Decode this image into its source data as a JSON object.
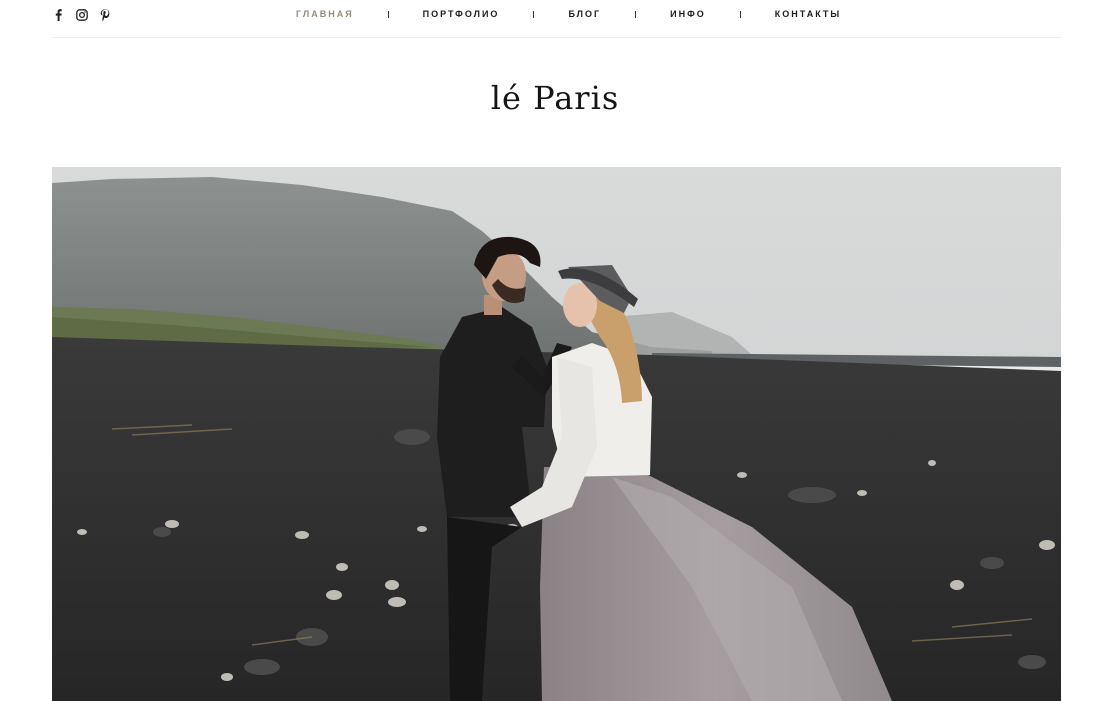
{
  "header": {
    "social": [
      {
        "icon": "facebook-icon",
        "symbol": "f"
      },
      {
        "icon": "instagram-icon",
        "symbol": "ig"
      },
      {
        "icon": "pinterest-icon",
        "symbol": "p"
      }
    ],
    "nav": {
      "items": [
        {
          "label": "ГЛАВНАЯ",
          "active": true
        },
        {
          "label": "ПОРТФОЛИО",
          "active": false
        },
        {
          "label": "БЛОГ",
          "active": false
        },
        {
          "label": "ИНФО",
          "active": false
        },
        {
          "label": "КОНТАКТЫ",
          "active": false
        }
      ],
      "active_color": "#9a8a7a",
      "text_color": "#1d1d1d"
    }
  },
  "site": {
    "title": "lé Paris"
  },
  "hero": {
    "image_subject": "couple-on-black-sand-beach-photo"
  }
}
